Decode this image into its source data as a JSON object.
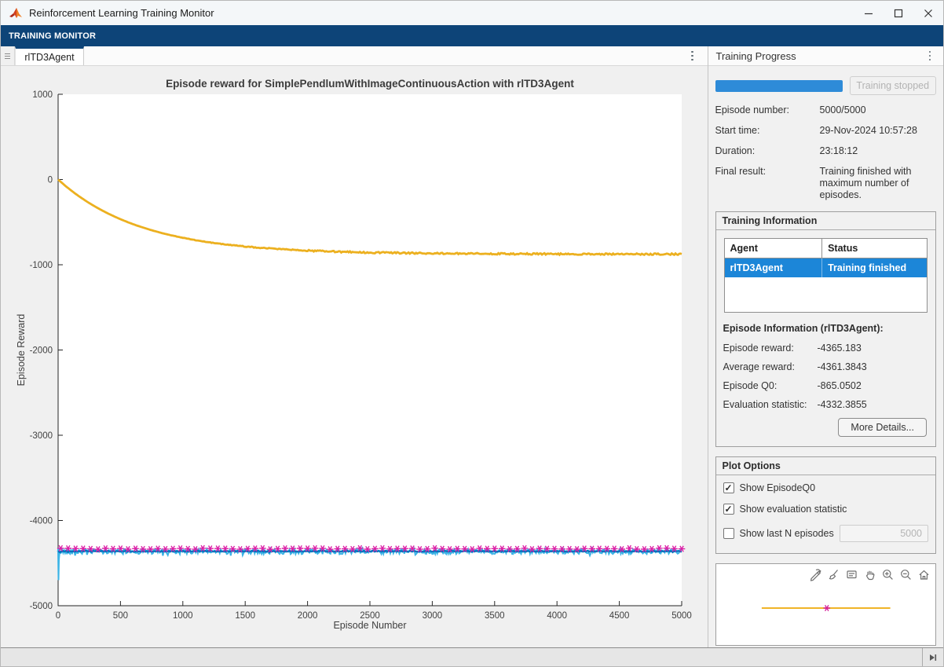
{
  "window": {
    "title": "Reinforcement Learning Training Monitor"
  },
  "toolstrip": {
    "tab_label": "TRAINING MONITOR"
  },
  "document_tabs": {
    "active_tab": "rlTD3Agent"
  },
  "right_panel": {
    "title": "Training Progress",
    "progress": {
      "percent": 100,
      "status_button_label": "Training stopped"
    },
    "fields": [
      {
        "label": "Episode number:",
        "value": "5000/5000"
      },
      {
        "label": "Start time:",
        "value": "29-Nov-2024 10:57:28"
      },
      {
        "label": "Duration:",
        "value": "23:18:12"
      },
      {
        "label": "Final result:",
        "value": "Training finished with maximum number of episodes."
      }
    ],
    "training_information": {
      "title": "Training Information",
      "table": {
        "columns": [
          "Agent",
          "Status"
        ],
        "rows": [
          {
            "agent": "rlTD3Agent",
            "status": "Training finished",
            "selected": true
          }
        ]
      },
      "episode_info_title": "Episode Information (rlTD3Agent):",
      "stats": [
        {
          "label": "Episode reward:",
          "value": "-4365.183"
        },
        {
          "label": "Average reward:",
          "value": "-4361.3843"
        },
        {
          "label": "Episode Q0:",
          "value": "-865.0502"
        },
        {
          "label": "Evaluation statistic:",
          "value": "-4332.3855"
        }
      ],
      "more_details_label": "More Details..."
    },
    "plot_options": {
      "title": "Plot Options",
      "check_glyph": "✓",
      "options": [
        {
          "label": "Show EpisodeQ0",
          "checked": true
        },
        {
          "label": "Show evaluation statistic",
          "checked": true
        },
        {
          "label": "Show last N episodes",
          "checked": false,
          "input_value": "5000",
          "input_disabled": true
        }
      ]
    },
    "preview_panel": {
      "tools": [
        "export",
        "brush",
        "datatips",
        "pan",
        "zoom-in",
        "zoom-out",
        "restore-view"
      ],
      "line_color": "#f0b428",
      "marker_color": "#d6219c"
    }
  },
  "chart_data": {
    "type": "line",
    "title": "Episode reward for SimplePendlumWithImageContinuousAction with rlTD3Agent",
    "xlabel": "Episode Number",
    "ylabel": "Episode Reward",
    "xlim": [
      0,
      5000
    ],
    "ylim": [
      -5000,
      1000
    ],
    "xticks": [
      0,
      500,
      1000,
      1500,
      2000,
      2500,
      3000,
      3500,
      4000,
      4500,
      5000
    ],
    "yticks": [
      1000,
      0,
      -1000,
      -2000,
      -3000,
      -4000,
      -5000
    ],
    "grid": false,
    "legend": "none",
    "series": [
      {
        "name": "Episode reward",
        "type": "noisy-line",
        "color": "#3CB4E6",
        "mean": -4365,
        "noise": 30,
        "x_range": [
          0,
          5000
        ],
        "initial_points": {
          "x": [
            0,
            3,
            6,
            10,
            14
          ],
          "y": [
            -4330,
            -4700,
            -4460,
            -4395,
            -4365
          ]
        }
      },
      {
        "name": "Average reward",
        "type": "noisy-line",
        "color": "#0072BD",
        "mean": -4361,
        "noise": 5,
        "x_range": [
          0,
          5000
        ]
      },
      {
        "name": "Episode Q0",
        "type": "exp-decay",
        "color": "#ECB01F",
        "start": 0,
        "asymptote": -876,
        "tau": 660,
        "noise": 9,
        "x_range": [
          0,
          5000
        ],
        "samples_x": [
          0,
          250,
          500,
          750,
          1000,
          1250,
          1500,
          2000,
          2500,
          3000,
          3500,
          4000,
          4500,
          5000
        ],
        "samples_y": [
          0,
          -280,
          -470,
          -600,
          -690,
          -750,
          -790,
          -835,
          -856,
          -866,
          -871,
          -873,
          -874,
          -876
        ]
      },
      {
        "name": "Evaluation statistic",
        "type": "star-markers",
        "color": "#DC1FA6",
        "mean": -4332,
        "noise": 7,
        "interval": 60,
        "x_range": [
          20,
          5000
        ]
      }
    ]
  }
}
